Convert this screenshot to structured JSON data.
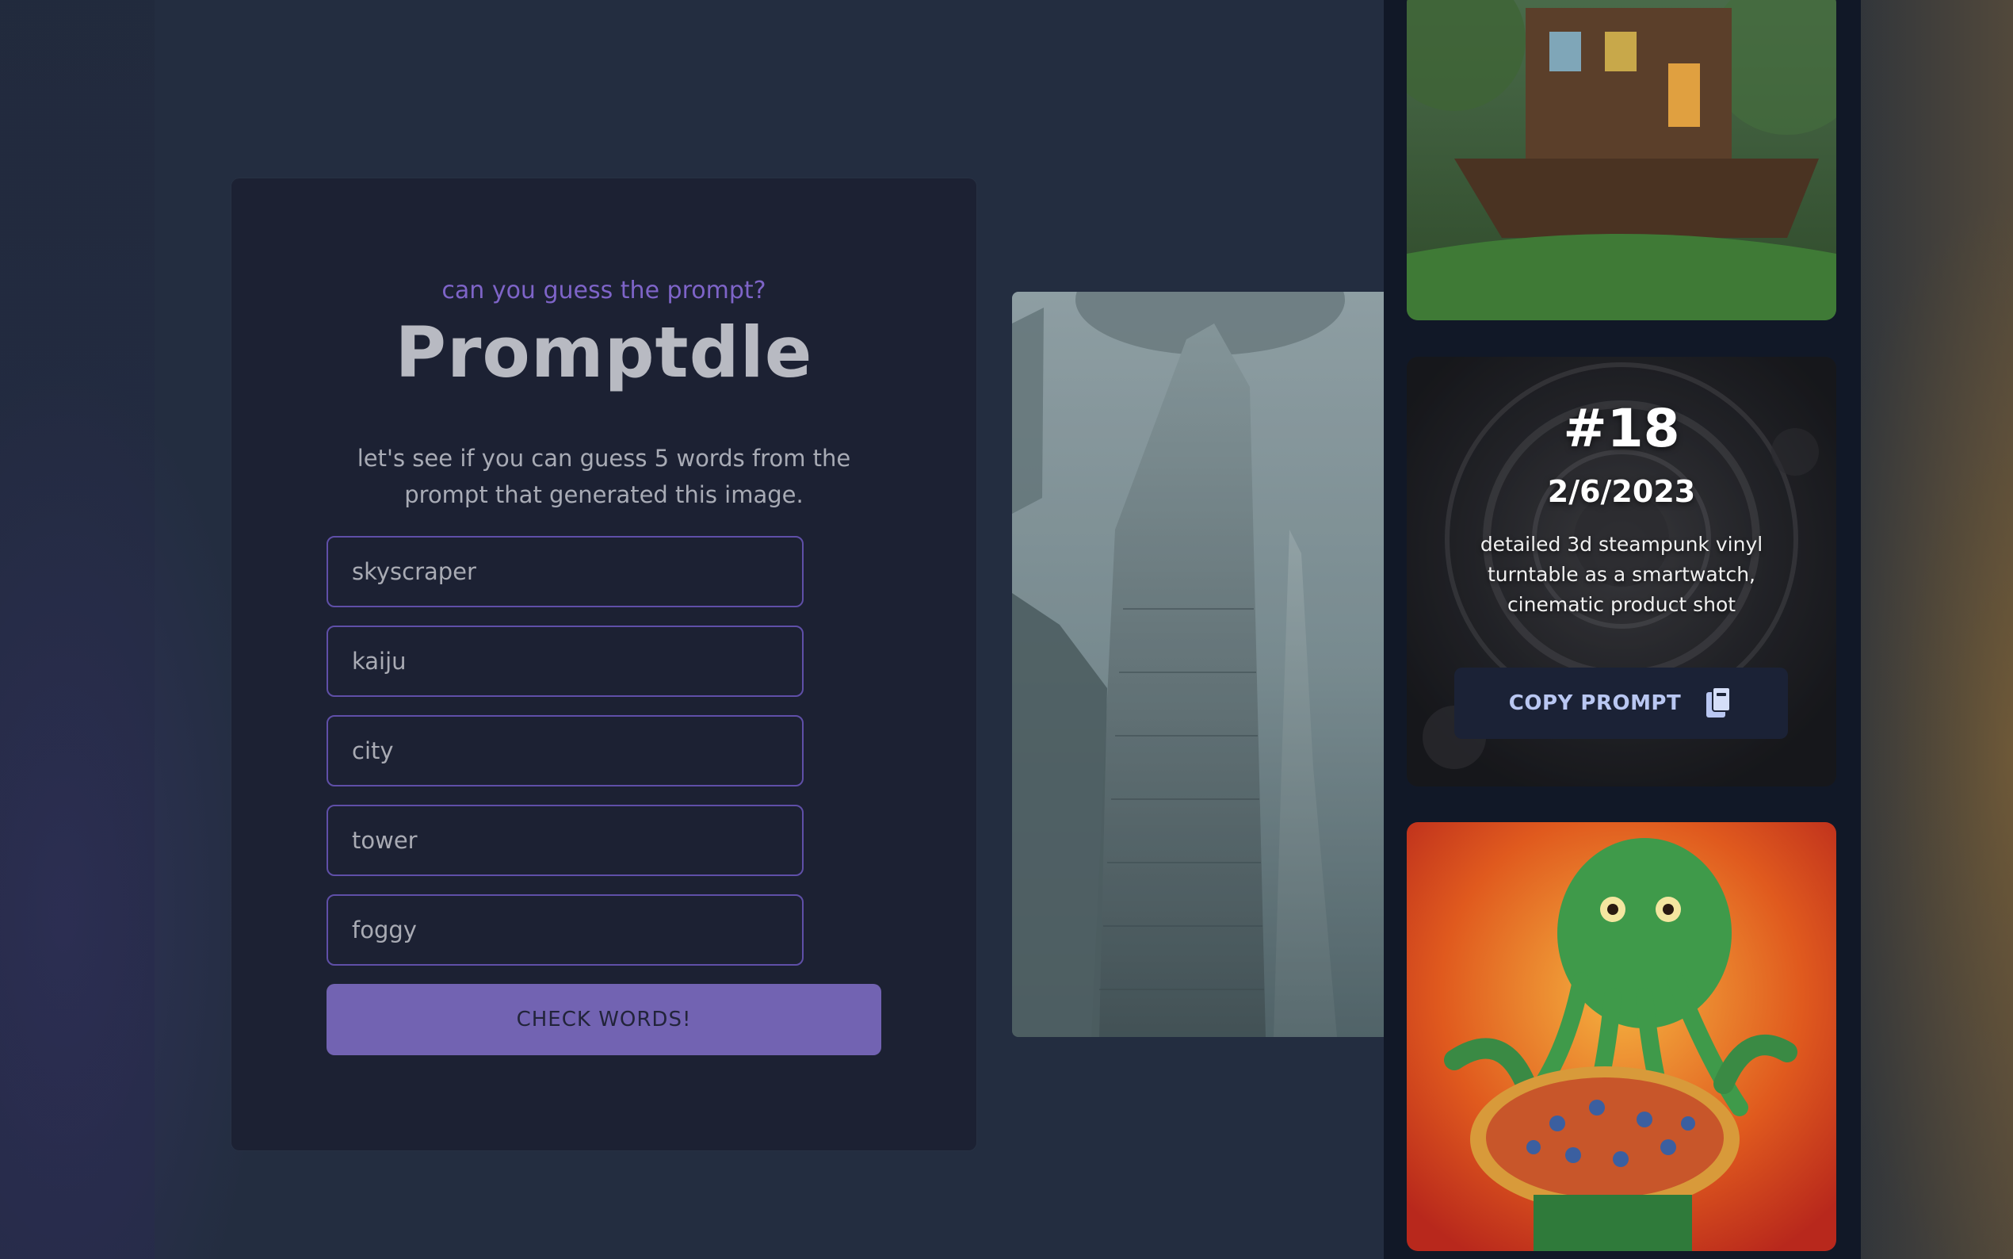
{
  "game": {
    "subtitle": "can you guess the prompt?",
    "title": "Promptdle",
    "description": "let's see if you can guess 5 words from the prompt that generated this image."
  },
  "guesses": [
    {
      "value": "skyscraper"
    },
    {
      "value": "kaiju"
    },
    {
      "value": "city"
    },
    {
      "value": "tower"
    },
    {
      "value": "foggy"
    }
  ],
  "check_button_label": "CHECK WORDS!",
  "center_image": {
    "description_icon": "foggy-city-image"
  },
  "previous_puzzle": {
    "number": "#18",
    "date": "2/6/2023",
    "prompt": "detailed 3d steampunk vinyl turntable as a smartwatch, cinematic product shot",
    "copy_label": "COPY PROMPT",
    "copy_icon": "clipboard-icon"
  },
  "gallery": {
    "top_image": "jungle-house-boat-image",
    "middle_image": "steampunk-turntable-image",
    "bottom_image": "cthulhu-pizza-image"
  },
  "colors": {
    "accent": "#7263b2",
    "subtitle": "#7e64c8",
    "panel": "#1c2133",
    "background": "#232d40",
    "input_border": "#5f4fa8"
  }
}
